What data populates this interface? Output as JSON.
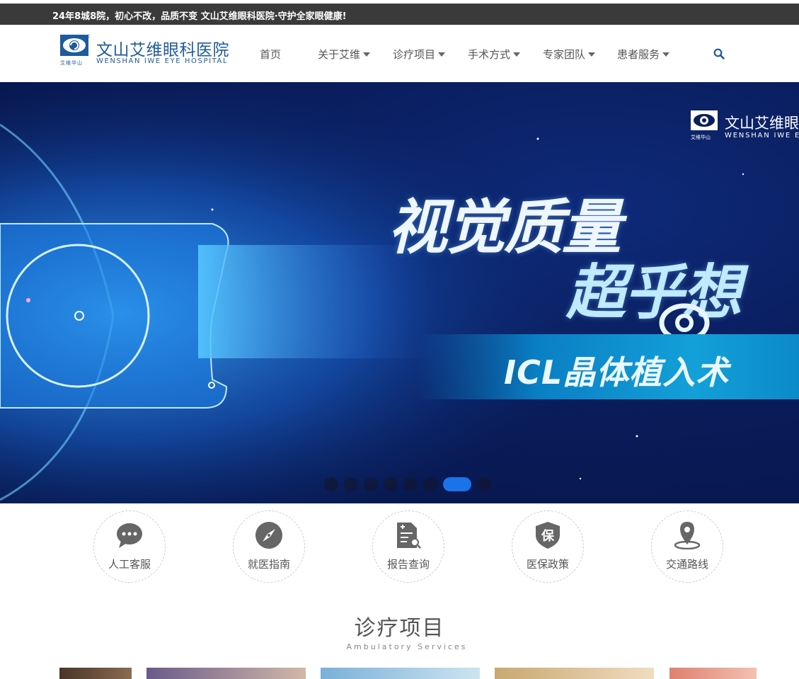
{
  "topbar": {
    "text": "24年8城8院，初心不改，品质不变 文山艾维眼科医院·守护全家眼健康!"
  },
  "logo": {
    "cn": "文山艾维眼科医院",
    "en": "WENSHAN IWE EYE HOSPITAL",
    "sub": "艾维华山"
  },
  "nav": [
    {
      "label": "首页",
      "dropdown": false
    },
    {
      "label": "关于艾维",
      "dropdown": true
    },
    {
      "label": "诊疗项目",
      "dropdown": true
    },
    {
      "label": "手术方式",
      "dropdown": true
    },
    {
      "label": "专家团队",
      "dropdown": true
    },
    {
      "label": "患者服务",
      "dropdown": true
    }
  ],
  "banner": {
    "logo_cn": "文山艾维眼",
    "logo_en": "WENSHAN IWE E",
    "logo_sub": "艾维华山",
    "headline_1": "视觉质量",
    "headline_2": "超乎想",
    "ribbon": "ICL晶体植入术",
    "slide_count": 8,
    "active_slide": 7
  },
  "services": [
    {
      "label": "人工客服",
      "icon": "chat-icon"
    },
    {
      "label": "就医指南",
      "icon": "compass-icon"
    },
    {
      "label": "报告查询",
      "icon": "report-search-icon"
    },
    {
      "label": "医保政策",
      "icon": "shield-insurance-icon"
    },
    {
      "label": "交通路线",
      "icon": "location-pin-icon"
    }
  ],
  "section": {
    "title": "诊疗项目",
    "subtitle": "Ambulatory Services"
  },
  "colors": {
    "brand": "#1e5a9c",
    "accent": "#1a73e8",
    "topbar": "#3a3a3a"
  }
}
